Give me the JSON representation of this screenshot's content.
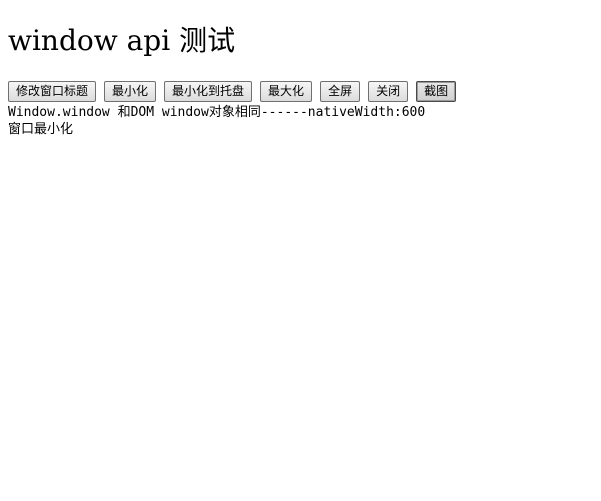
{
  "page": {
    "title": "window api 测试"
  },
  "toolbar": {
    "buttons": [
      {
        "label": "修改窗口标题"
      },
      {
        "label": "最小化"
      },
      {
        "label": "最小化到托盘"
      },
      {
        "label": "最大化"
      },
      {
        "label": "全屏"
      },
      {
        "label": "关闭"
      },
      {
        "label": "截图"
      }
    ]
  },
  "output": {
    "lines": [
      "Window.window 和DOM window对象相同------nativeWidth:600",
      "窗口最小化"
    ]
  }
}
